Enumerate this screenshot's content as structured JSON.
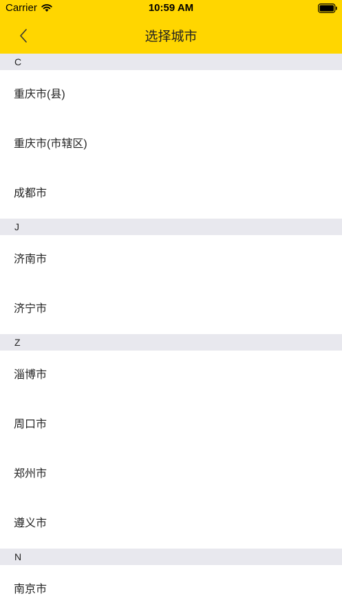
{
  "status_bar": {
    "carrier": "Carrier",
    "time": "10:59 AM"
  },
  "nav": {
    "title": "选择城市",
    "back_icon": "chevron-left-icon",
    "background_color": "#FFD600"
  },
  "sections": [
    {
      "letter": "C",
      "cities": [
        "重庆市(县)",
        "重庆市(市辖区)",
        "成都市"
      ]
    },
    {
      "letter": "J",
      "cities": [
        "济南市",
        "济宁市"
      ]
    },
    {
      "letter": "Z",
      "cities": [
        "淄博市",
        "周口市",
        "郑州市",
        "遵义市"
      ]
    },
    {
      "letter": "N",
      "cities": [
        "南京市"
      ]
    }
  ]
}
